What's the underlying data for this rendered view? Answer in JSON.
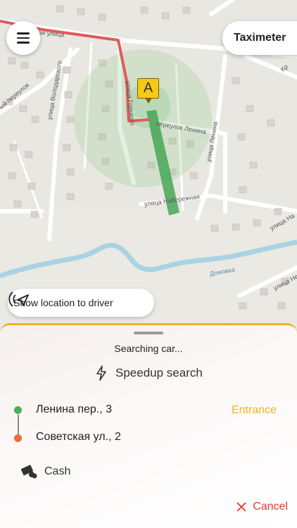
{
  "header": {
    "menu_icon": "hamburger-icon",
    "taximeter_label": "Taximeter"
  },
  "map": {
    "pin_label": "A",
    "streets": [
      "улица Володарского",
      "переулок Ленина",
      "улица Горького",
      "улица Набережная",
      "улица Ленина",
      "Домовка",
      "улица Не",
      "улица На",
      "Кр",
      "ый переулок",
      "Ленинская улица"
    ],
    "show_location_label": "Show location to driver",
    "show_location_icon": "location-broadcast-icon"
  },
  "sheet": {
    "status": "Searching car...",
    "speedup_label": "Speedup search",
    "speedup_icon": "lightning-icon",
    "route": {
      "from": "Ленина пер., 3",
      "to": "Советская ул., 2",
      "entrance_label": "Entrance"
    },
    "payment": {
      "label": "Cash",
      "icon": "cash-icon"
    },
    "cancel_label": "Cancel",
    "cancel_icon": "close-icon"
  },
  "colors": {
    "accent": "#f0b321",
    "route_red": "#e05a5a",
    "start_green": "#4caf50",
    "end_orange": "#ef6b3a",
    "cancel_red": "#e53935",
    "river": "#a8d3e3"
  }
}
